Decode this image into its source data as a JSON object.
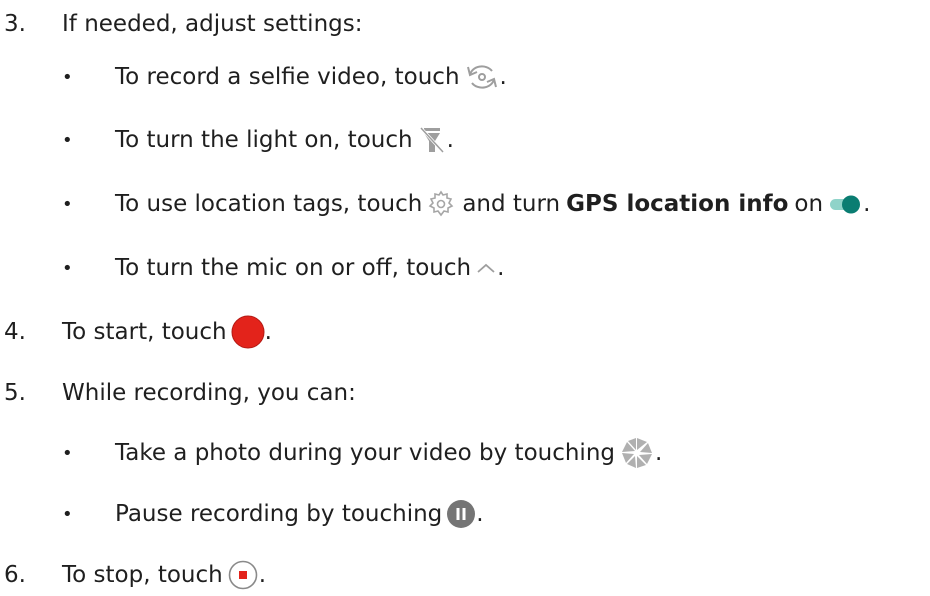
{
  "steps": [
    {
      "num": "3.",
      "text": "If needed, adjust settings:"
    },
    {
      "num": "4.",
      "text_before": "To start, touch",
      "text_after": "."
    },
    {
      "num": "5.",
      "text": "While recording, you can:"
    },
    {
      "num": "6.",
      "text_before": "To stop, touch",
      "text_after": "."
    }
  ],
  "bullets": {
    "selfie": {
      "before": "To record a selfie video, touch",
      "after": ".",
      "icon": "switch-camera-icon"
    },
    "light": {
      "before": "To turn the light on, touch",
      "after": ".",
      "icon": "flash-off-icon"
    },
    "location": {
      "before": "To use location tags, touch",
      "middle": "and turn",
      "bold": "GPS location info",
      "on": "on",
      "after": ".",
      "icon": "settings-icon",
      "icon2": "toggle-on-icon"
    },
    "mic": {
      "before": "To turn the mic on or off, touch",
      "after": ".",
      "icon": "chevron-up-icon"
    },
    "photo": {
      "before": "Take a photo during your video by touching",
      "after": ".",
      "icon": "shutter-icon"
    },
    "pause": {
      "before": "Pause recording by touching",
      "after": ".",
      "icon": "pause-icon"
    }
  },
  "bullet_char": "•",
  "colors": {
    "record": "#e3231b",
    "toggle": "#0a7d72",
    "toggle_track": "#8fd3c9",
    "icon_gray": "#9e9e9e",
    "pause_bg": "#757575"
  }
}
